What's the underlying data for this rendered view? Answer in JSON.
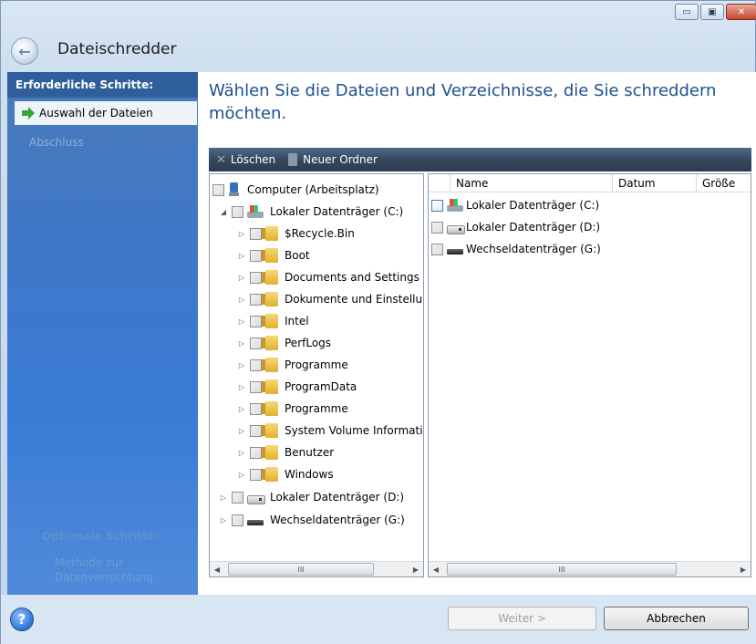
{
  "window": {
    "title": "Dateischredder",
    "controls": {
      "minimize": "▭",
      "maximize": "▣",
      "close": "✕"
    }
  },
  "sidebar": {
    "header": "Erforderliche Schritte:",
    "items": [
      {
        "label": "Auswahl der Dateien",
        "active": true
      },
      {
        "label": "Abschluss",
        "active": false
      }
    ],
    "optional_header": "Optionale Schritte:",
    "optional_items": [
      {
        "label": "Methode zur Datenvernichtung"
      }
    ]
  },
  "main": {
    "heading": "Wählen Sie die Dateien und Verzeichnisse, die Sie schreddern möchten."
  },
  "toolbar": {
    "delete_label": "Löschen",
    "new_folder_label": "Neuer Ordner"
  },
  "tree": {
    "items": [
      {
        "label": "Computer (Arbeitsplatz)",
        "icon": "computer-icon"
      },
      {
        "label": "Lokaler Datenträger (C:)",
        "icon": "drive-c-icon",
        "expanded": true
      },
      {
        "label": "$Recycle.Bin",
        "icon": "folder-icon"
      },
      {
        "label": "Boot",
        "icon": "folder-icon"
      },
      {
        "label": "Documents and Settings",
        "icon": "folder-icon"
      },
      {
        "label": "Dokumente und Einstellungen",
        "icon": "folder-icon"
      },
      {
        "label": "Intel",
        "icon": "folder-icon"
      },
      {
        "label": "PerfLogs",
        "icon": "folder-icon"
      },
      {
        "label": "Programme",
        "icon": "folder-icon"
      },
      {
        "label": "ProgramData",
        "icon": "folder-icon"
      },
      {
        "label": "Programme",
        "icon": "folder-icon"
      },
      {
        "label": "System Volume Information",
        "icon": "folder-icon"
      },
      {
        "label": "Benutzer",
        "icon": "folder-icon"
      },
      {
        "label": "Windows",
        "icon": "folder-icon"
      },
      {
        "label": "Lokaler Datenträger (D:)",
        "icon": "drive-d-icon"
      },
      {
        "label": "Wechseldatenträger (G:)",
        "icon": "drive-g-icon"
      }
    ]
  },
  "list": {
    "columns": [
      "Name",
      "Datum",
      "Größe"
    ],
    "rows": [
      {
        "name": "Lokaler Datenträger (C:)",
        "icon": "drive-c-icon"
      },
      {
        "name": "Lokaler Datenträger (D:)",
        "icon": "drive-d-icon"
      },
      {
        "name": "Wechseldatenträger (G:)",
        "icon": "drive-g-icon"
      }
    ]
  },
  "scrollbar": {
    "thumb_grip": "III",
    "left_arrow": "◀",
    "right_arrow": "▶"
  },
  "buttons": {
    "help": "?",
    "back": "←",
    "next_label": "Weiter >",
    "cancel_label": "Abbrechen"
  }
}
